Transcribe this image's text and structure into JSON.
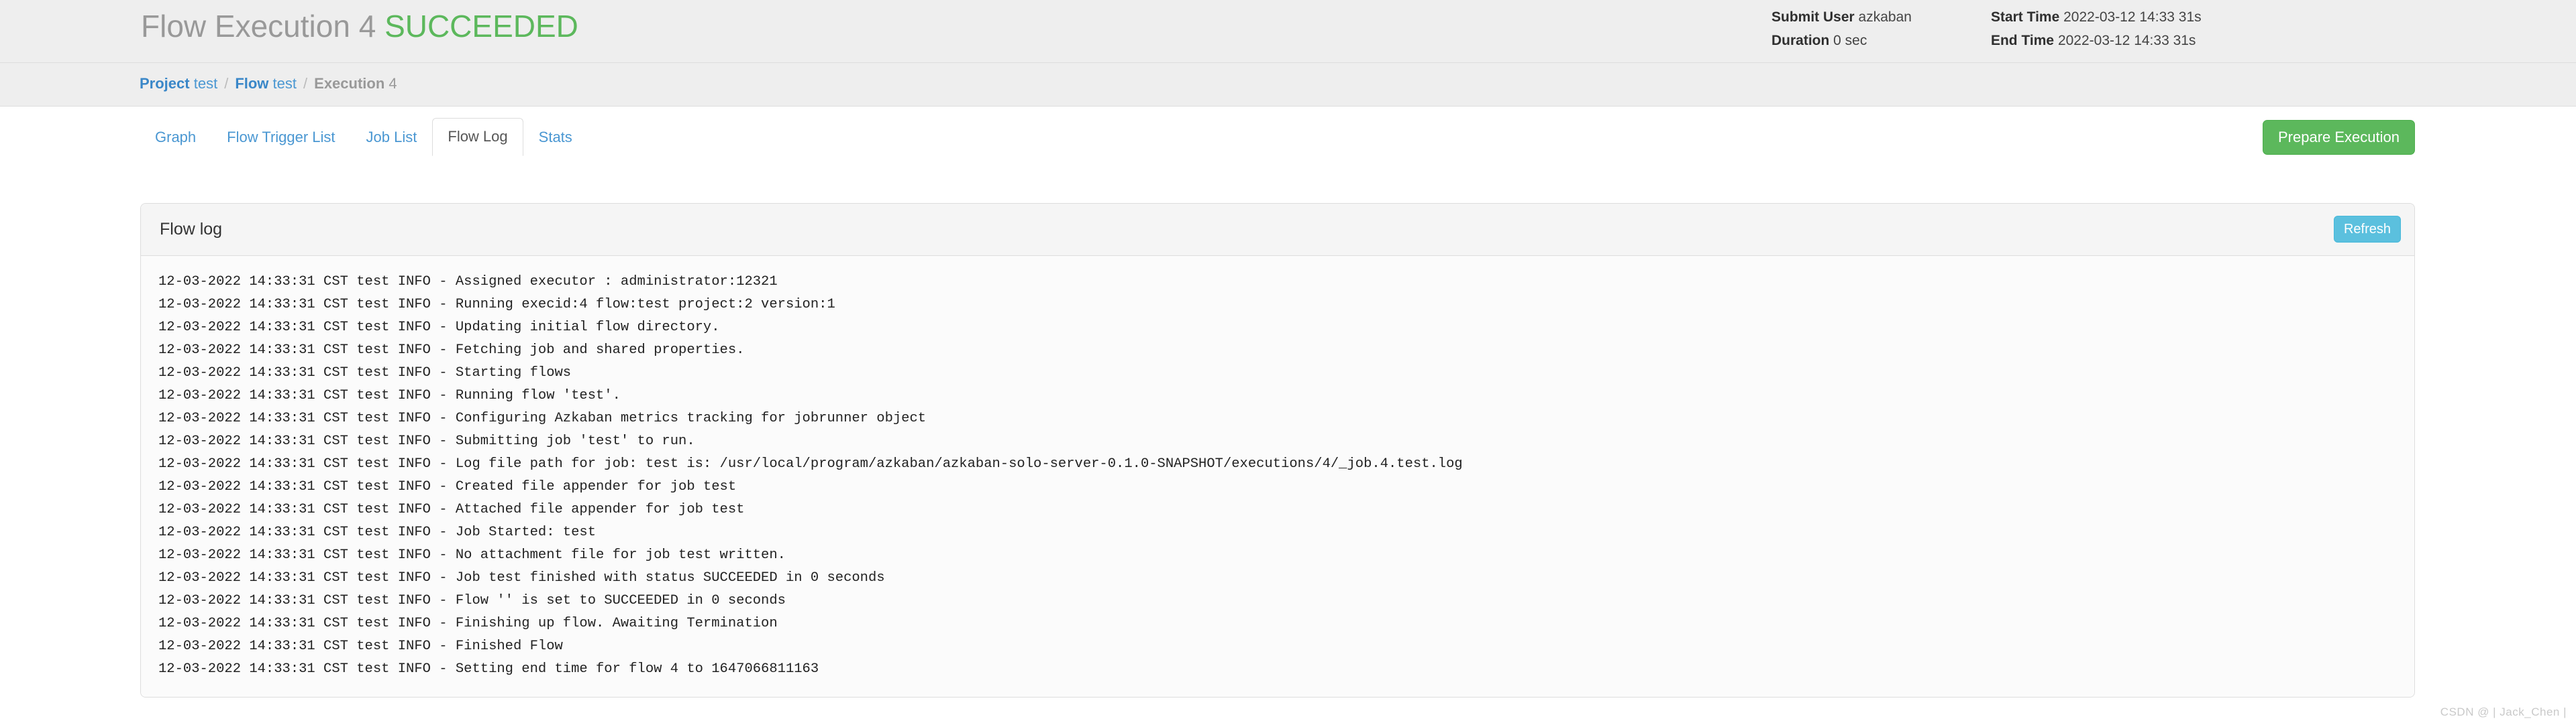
{
  "header": {
    "title_main": "Flow Execution 4",
    "title_status": "SUCCEEDED",
    "status_color": "#5cb85c",
    "meta": {
      "submit_user_label": "Submit User",
      "submit_user_value": "azkaban",
      "duration_label": "Duration",
      "duration_value": "0 sec",
      "start_time_label": "Start Time",
      "start_time_value": "2022-03-12 14:33 31s",
      "end_time_label": "End Time",
      "end_time_value": "2022-03-12 14:33 31s"
    }
  },
  "breadcrumb": {
    "project_label": "Project",
    "project_value": "test",
    "flow_label": "Flow",
    "flow_value": "test",
    "execution_label": "Execution",
    "execution_value": "4",
    "separator": "/"
  },
  "tabs": [
    {
      "label": "Graph",
      "active": false
    },
    {
      "label": "Flow Trigger List",
      "active": false
    },
    {
      "label": "Job List",
      "active": false
    },
    {
      "label": "Flow Log",
      "active": true
    },
    {
      "label": "Stats",
      "active": false
    }
  ],
  "actions": {
    "prepare_execution_label": "Prepare Execution",
    "prepare_execution_color": "#5cb85c",
    "refresh_label": "Refresh",
    "refresh_color": "#5bc0de"
  },
  "panel": {
    "title": "Flow log",
    "log_lines": [
      "12-03-2022 14:33:31 CST test INFO - Assigned executor : administrator:12321",
      "12-03-2022 14:33:31 CST test INFO - Running execid:4 flow:test project:2 version:1",
      "12-03-2022 14:33:31 CST test INFO - Updating initial flow directory.",
      "12-03-2022 14:33:31 CST test INFO - Fetching job and shared properties.",
      "12-03-2022 14:33:31 CST test INFO - Starting flows",
      "12-03-2022 14:33:31 CST test INFO - Running flow 'test'.",
      "12-03-2022 14:33:31 CST test INFO - Configuring Azkaban metrics tracking for jobrunner object",
      "12-03-2022 14:33:31 CST test INFO - Submitting job 'test' to run.",
      "12-03-2022 14:33:31 CST test INFO - Log file path for job: test is: /usr/local/program/azkaban/azkaban-solo-server-0.1.0-SNAPSHOT/executions/4/_job.4.test.log",
      "12-03-2022 14:33:31 CST test INFO - Created file appender for job test",
      "12-03-2022 14:33:31 CST test INFO - Attached file appender for job test",
      "12-03-2022 14:33:31 CST test INFO - Job Started: test",
      "12-03-2022 14:33:31 CST test INFO - No attachment file for job test written.",
      "12-03-2022 14:33:31 CST test INFO - Job test finished with status SUCCEEDED in 0 seconds",
      "12-03-2022 14:33:31 CST test INFO - Flow '' is set to SUCCEEDED in 0 seconds",
      "12-03-2022 14:33:31 CST test INFO - Finishing up flow. Awaiting Termination",
      "12-03-2022 14:33:31 CST test INFO - Finished Flow",
      "12-03-2022 14:33:31 CST test INFO - Setting end time for flow 4 to 1647066811163"
    ]
  },
  "watermark": {
    "text": "CSDN @ | Jack_Chen |"
  }
}
